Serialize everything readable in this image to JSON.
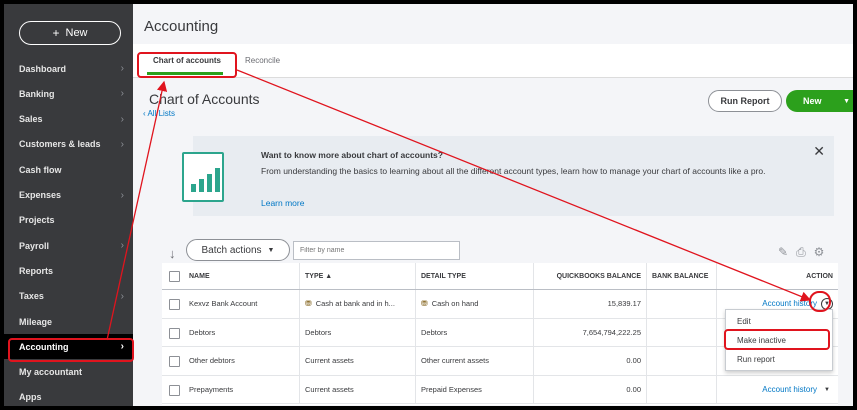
{
  "sidebar": {
    "new_label": "New",
    "items": [
      {
        "label": "Dashboard",
        "chevron": true
      },
      {
        "label": "Banking",
        "chevron": true
      },
      {
        "label": "Sales",
        "chevron": true
      },
      {
        "label": "Customers & leads",
        "chevron": true
      },
      {
        "label": "Cash flow",
        "chevron": false
      },
      {
        "label": "Expenses",
        "chevron": true
      },
      {
        "label": "Projects",
        "chevron": false
      },
      {
        "label": "Payroll",
        "chevron": true
      },
      {
        "label": "Reports",
        "chevron": false
      },
      {
        "label": "Taxes",
        "chevron": true
      },
      {
        "label": "Mileage",
        "chevron": false
      },
      {
        "label": "Accounting",
        "chevron": true,
        "active": true
      },
      {
        "label": "My accountant",
        "chevron": false
      },
      {
        "label": "Apps",
        "chevron": false
      }
    ]
  },
  "header": {
    "title": "Accounting",
    "tabs": [
      {
        "label": "Chart of accounts",
        "active": true
      },
      {
        "label": "Reconcile",
        "active": false
      }
    ]
  },
  "page": {
    "title": "Chart of Accounts",
    "all_lists": "All Lists",
    "run_report": "Run Report",
    "new_label": "New"
  },
  "banner": {
    "title": "Want to know more about chart of accounts?",
    "text": "From understanding the basics to learning about all the different account types, learn how to manage your chart of accounts like a pro.",
    "link": "Learn more"
  },
  "toolbar": {
    "batch_actions": "Batch actions",
    "filter_placeholder": "Filter by name"
  },
  "table": {
    "headers": [
      "NAME",
      "TYPE ▲",
      "DETAIL TYPE",
      "QUICKBOOKS BALANCE",
      "BANK BALANCE",
      "ACTION"
    ],
    "rows": [
      {
        "name": "Kexvz Bank Account",
        "type": "Cash at bank and in h...",
        "detail": "Cash on hand",
        "qb_balance": "15,839.17",
        "bank_balance": "",
        "action": "Account history",
        "type_icon": true
      },
      {
        "name": "Debtors",
        "type": "Debtors",
        "detail": "Debtors",
        "qb_balance": "7,654,794,222.25",
        "bank_balance": "",
        "action": "",
        "type_icon": false
      },
      {
        "name": "Other debtors",
        "type": "Current assets",
        "detail": "Other current assets",
        "qb_balance": "0.00",
        "bank_balance": "",
        "action": "",
        "type_icon": false
      },
      {
        "name": "Prepayments",
        "type": "Current assets",
        "detail": "Prepaid Expenses",
        "qb_balance": "0.00",
        "bank_balance": "",
        "action": "Account history",
        "type_icon": false
      }
    ]
  },
  "menu": {
    "items": [
      "Edit",
      "Make inactive",
      "Run report"
    ]
  },
  "colors": {
    "accent_green": "#2ca01c",
    "link_blue": "#0077c5",
    "annotation_red": "#e0141e",
    "sidebar_bg": "#393a3d"
  }
}
